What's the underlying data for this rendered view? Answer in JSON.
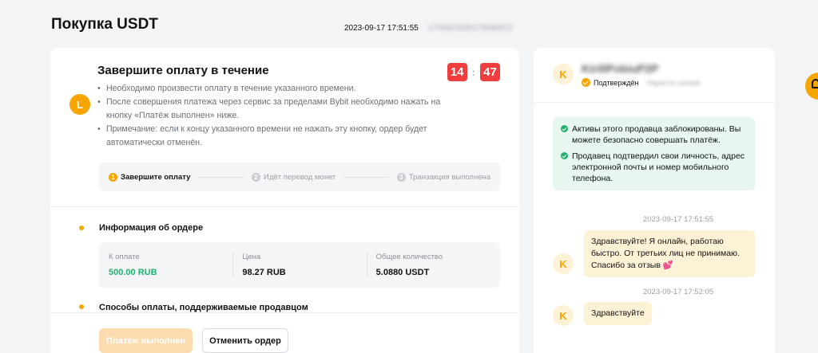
{
  "page": {
    "title": "Покупка USDT",
    "timestamp": "2023-09-17 17:51:55",
    "order_id": "1703421525175090912"
  },
  "payment": {
    "avatar_letter": "L",
    "title": "Завершите оплату в течение",
    "timer": {
      "minutes": "14",
      "separator": ":",
      "seconds": "47"
    },
    "rules": [
      "Необходимо произвести оплату в течение указанного времени.",
      "После совершения платежа через сервис за пределами Bybit необходимо нажать на кнопку «Платёж выполнен» ниже.",
      "Примечание: если к концу указанного времени не нажать эту кнопку, ордер будет автоматически отменён."
    ],
    "steps": [
      {
        "num": "1",
        "label": "Завершите оплату"
      },
      {
        "num": "2",
        "label": "Идёт перевод монет"
      },
      {
        "num": "3",
        "label": "Транзакция выполнена"
      }
    ]
  },
  "order_info": {
    "title": "Информация об ордере",
    "columns": [
      {
        "label": "К оплате",
        "value": "500.00 RUB"
      },
      {
        "label": "Цена",
        "value": "98.27 RUB"
      },
      {
        "label": "Общее количество",
        "value": "5.0880 USDT"
      }
    ]
  },
  "payment_methods": {
    "title": "Способы оплаты, поддерживаемые продавцом"
  },
  "footer": {
    "done_label": "Платёж выполнен",
    "cancel_label": "Отменить ордер"
  },
  "seller": {
    "avatar_letter": "K",
    "name": "KirillPobiuP2P",
    "verified_label": "Подтверждён",
    "verified_extra": "Наристи салаев",
    "notices": [
      "Активы этого продавца заблокированы. Вы можете безопасно совершать платёж.",
      "Продавец подтвердил свои личность, адрес электронной почты и номер мобильного телефона."
    ]
  },
  "chat": {
    "messages": [
      {
        "time": "2023-09-17 17:51:55",
        "avatar_letter": "K",
        "text": "Здравствуйте! Я онлайн, работаю быстро. От третьих лиц не принимаю. Спасибо за отзыв 💕"
      },
      {
        "time": "2023-09-17 17:52:05",
        "avatar_letter": "K",
        "text": "Здравствуйте"
      }
    ]
  },
  "colors": {
    "accent": "#f7a600",
    "danger": "#f03d3e",
    "success": "#20b26c"
  }
}
